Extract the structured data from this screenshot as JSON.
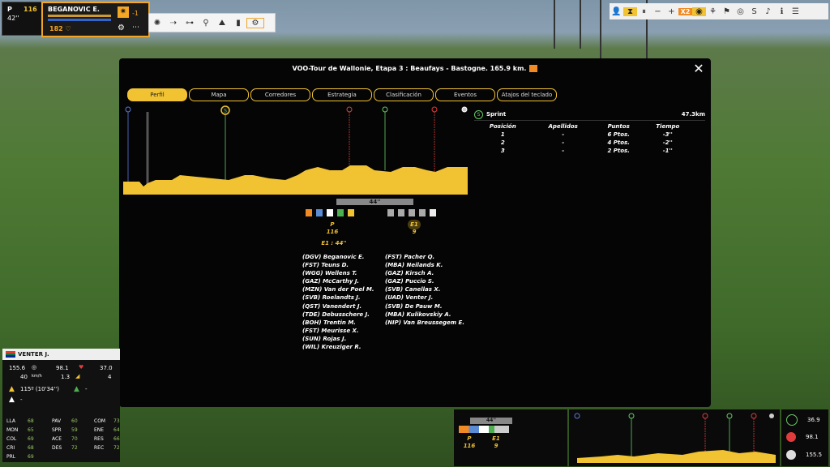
{
  "hud": {
    "position_label": "P",
    "position_value": "116",
    "time_gap": "42''",
    "rider_name": "BEGANOVIC E.",
    "energy": "182",
    "attack_value": "-1"
  },
  "modal": {
    "title": "VOO-Tour de Wallonie, Etapa 3 : Beaufays - Bastogne. 165.9 km.",
    "close_label": "✕",
    "tabs": [
      "Perfil",
      "Mapa",
      "Corredores",
      "Estrategia",
      "Clasificación",
      "Eventos",
      "Atajos del teclado"
    ],
    "active_tab": "Perfil"
  },
  "sprint": {
    "label": "Sprint",
    "km": "47.3km",
    "columns": [
      "Posición",
      "Apellidos",
      "Puntos",
      "Tiempo"
    ],
    "rows": [
      [
        "1",
        "-",
        "6 Ptos.",
        "-3''"
      ],
      [
        "2",
        "-",
        "4 Ptos.",
        "-2''"
      ],
      [
        "3",
        "-",
        "2 Ptos.",
        "-1''"
      ]
    ]
  },
  "groups": {
    "gap_bar": "44''",
    "peloton_label": "P",
    "peloton_count": "116",
    "break_label": "E1",
    "break_count": "9",
    "gap_text": "E1 : 44''"
  },
  "peloton_riders": [
    "(DGV) Beganovic E.",
    "(FST) Teuns D.",
    "(WGG) Wellens T.",
    "(GAZ) McCarthy J.",
    "(MZN) Van der Poel M.",
    "(SVB) Roelandts J.",
    "(QST) Vanendert J.",
    "(TDE) Debusschere J.",
    "(BOH) Trentin M.",
    "(FST) Meurisse X.",
    "(SUN) Rojas J.",
    "(WIL) Kreuziger R."
  ],
  "break_riders": [
    "(FST) Pacher Q.",
    "(MBA) Neilands K.",
    "(GAZ) Kirsch A.",
    "(GAZ) Puccio S.",
    "(SVB) Canellas X.",
    "(UAD) Venter J.",
    "(SVB) De Pauw M.",
    "(MBA) Kulikovskiy A.",
    "(NIP) Van Breussegem E."
  ],
  "rider_panel": {
    "name": "VENTER J.",
    "dist": "155.6",
    "power": "98.1",
    "speed": "37.0",
    "speed_val": "40",
    "speed_unit": "km/h",
    "grade": "1.3",
    "pos": "4",
    "leader_gap": "115º (10'34'')",
    "green": "-",
    "polka": "-",
    "stats": [
      [
        "LLA",
        "68"
      ],
      [
        "MON",
        "65"
      ],
      [
        "COL",
        "69"
      ],
      [
        "CRI",
        "68"
      ],
      [
        "PRL",
        "69"
      ],
      [
        "PAV",
        "60"
      ],
      [
        "SPR",
        "59"
      ],
      [
        "ACE",
        "70"
      ],
      [
        "DES",
        "72"
      ],
      [
        "COM",
        "73"
      ],
      [
        "ENE",
        "64"
      ],
      [
        "RES",
        "66"
      ],
      [
        "REC",
        "72"
      ]
    ]
  },
  "mini": {
    "gap": "44''",
    "p_label": "P",
    "p_count": "116",
    "e_label": "E1",
    "e_count": "9"
  },
  "side": {
    "sprint": "36.9",
    "climb": "98.1",
    "finish": "155.5"
  },
  "colors": {
    "accent": "#f1c232",
    "orange": "#f08a24",
    "green": "#66cc66",
    "red": "#e03c3c",
    "blue": "#5b7bd5"
  }
}
